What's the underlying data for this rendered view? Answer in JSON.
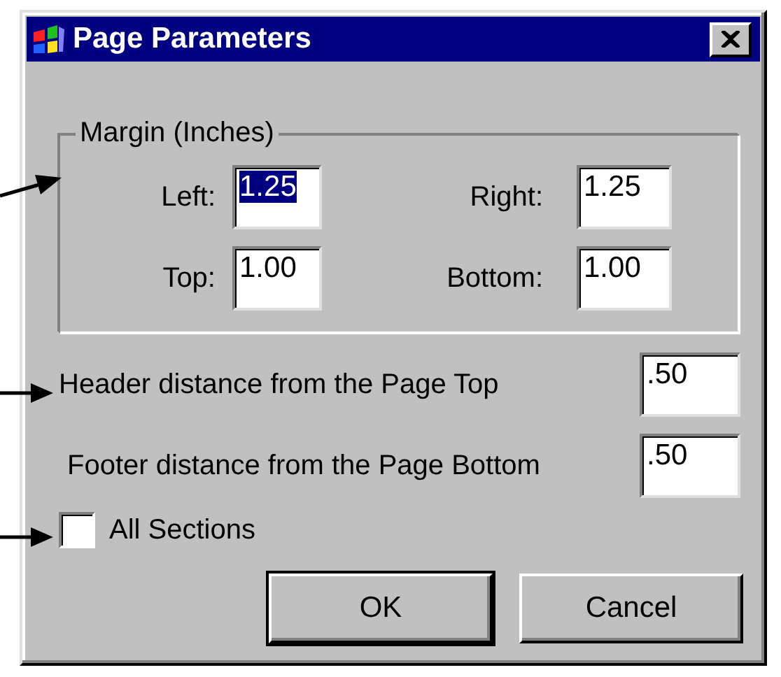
{
  "window": {
    "title": "Page Parameters"
  },
  "margin_group": {
    "title": "Margin (Inches)",
    "fields": [
      {
        "label": "Left:",
        "value": "1.25",
        "selected": true
      },
      {
        "label": "Right:",
        "value": "1.25",
        "selected": false
      },
      {
        "label": "Top:",
        "value": "1.00",
        "selected": false
      },
      {
        "label": "Bottom:",
        "value": "1.00",
        "selected": false
      }
    ]
  },
  "header_distance": {
    "label": "Header distance from the Page Top",
    "value": ".50"
  },
  "footer_distance": {
    "label": "Footer distance from the Page Bottom",
    "value": ".50"
  },
  "all_sections": {
    "label": "All Sections",
    "checked": false
  },
  "buttons": [
    {
      "label": "OK",
      "default": true
    },
    {
      "label": "Cancel",
      "default": false
    }
  ]
}
